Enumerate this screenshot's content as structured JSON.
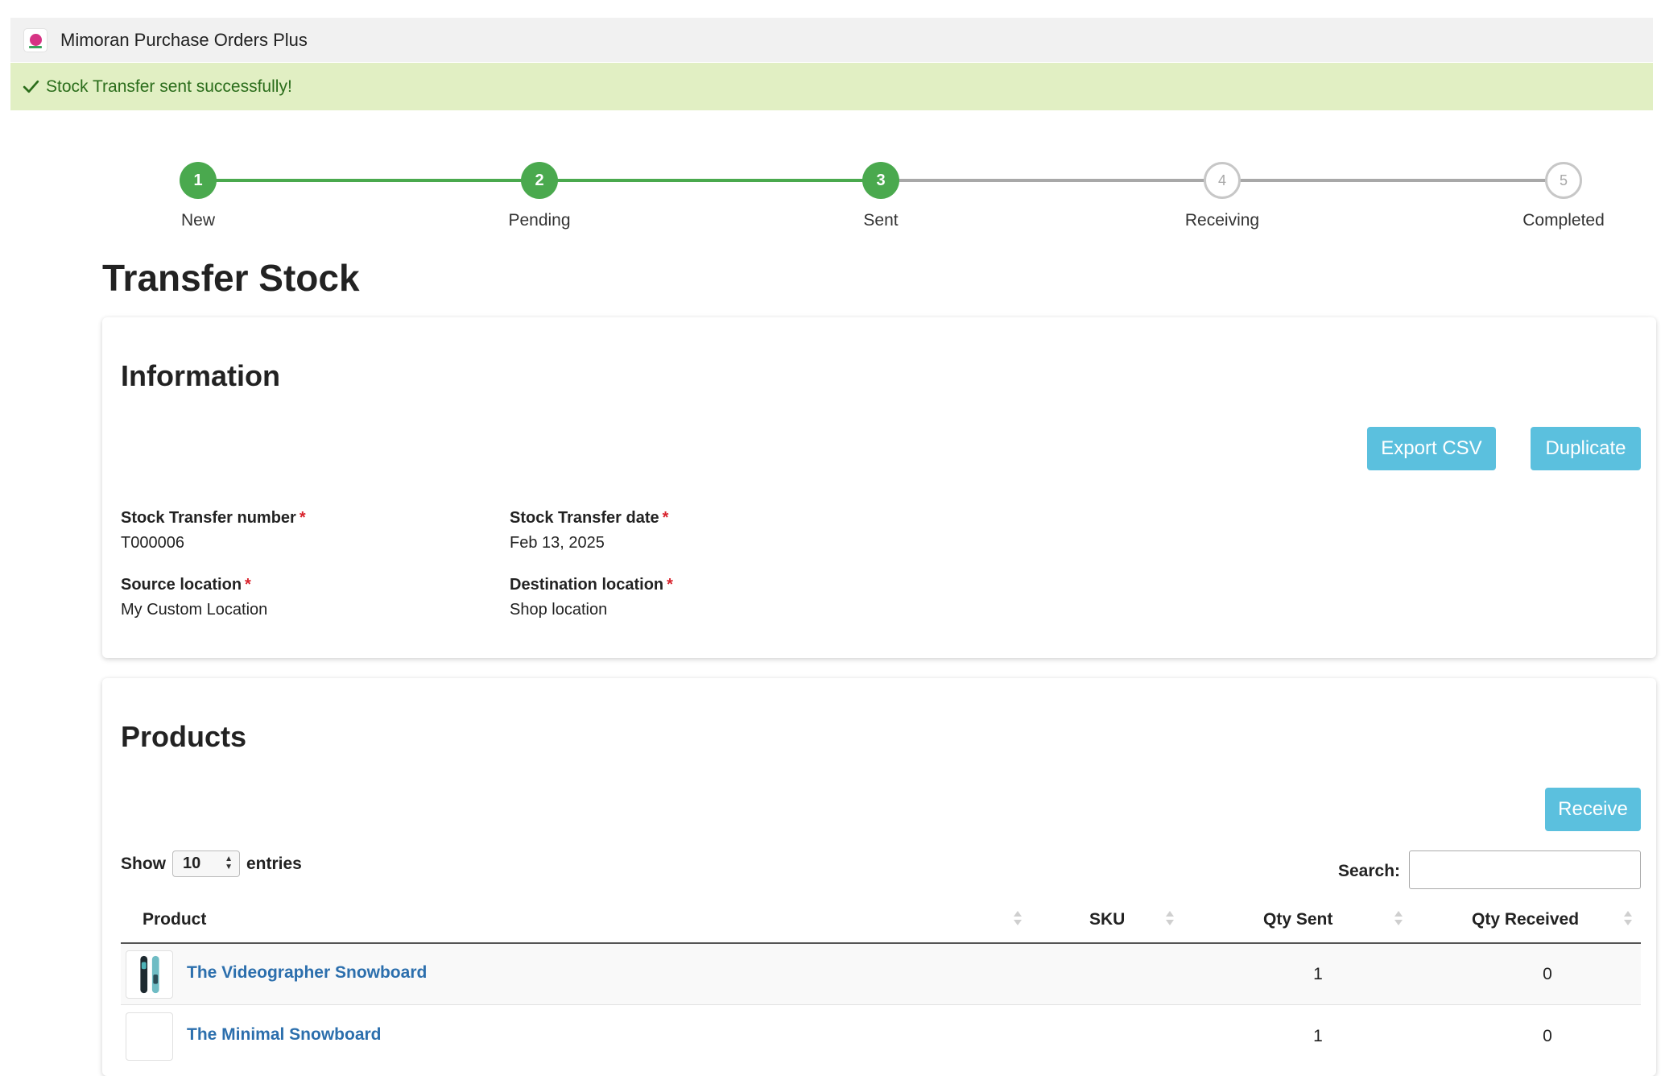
{
  "app": {
    "title": "Mimoran Purchase Orders Plus"
  },
  "banner": {
    "message": "Stock Transfer sent successfully!"
  },
  "steps": [
    {
      "number": "1",
      "label": "New",
      "status": "done"
    },
    {
      "number": "2",
      "label": "Pending",
      "status": "done"
    },
    {
      "number": "3",
      "label": "Sent",
      "status": "done"
    },
    {
      "number": "4",
      "label": "Receiving",
      "status": "todo"
    },
    {
      "number": "5",
      "label": "Completed",
      "status": "todo"
    }
  ],
  "page": {
    "title": "Transfer Stock"
  },
  "information": {
    "title": "Information",
    "export_label": "Export CSV",
    "duplicate_label": "Duplicate",
    "transfer_number_label": "Stock Transfer number",
    "transfer_number_value": "T000006",
    "transfer_date_label": "Stock Transfer date",
    "transfer_date_value": "Feb 13, 2025",
    "source_label": "Source location",
    "source_value": "My Custom Location",
    "destination_label": "Destination location",
    "destination_value": "Shop location",
    "required_mark": "*"
  },
  "products": {
    "title": "Products",
    "receive_label": "Receive",
    "show_label": "Show",
    "entries_value": "10",
    "entries_label": "entries",
    "search_label": "Search:",
    "search_value": "",
    "columns": [
      "Product",
      "SKU",
      "Qty Sent",
      "Qty Received"
    ],
    "rows": [
      {
        "product": "The Videographer Snowboard",
        "sku": "",
        "qty_sent": "1",
        "qty_received": "0"
      },
      {
        "product": "The Minimal Snowboard",
        "sku": "",
        "qty_sent": "1",
        "qty_received": "0"
      }
    ]
  },
  "colors": {
    "accent_button": "#5bc0de",
    "step_done": "#4aa94e",
    "success_banner": "#e1efc3",
    "link": "#2c6fad",
    "required": "#d9232d"
  }
}
